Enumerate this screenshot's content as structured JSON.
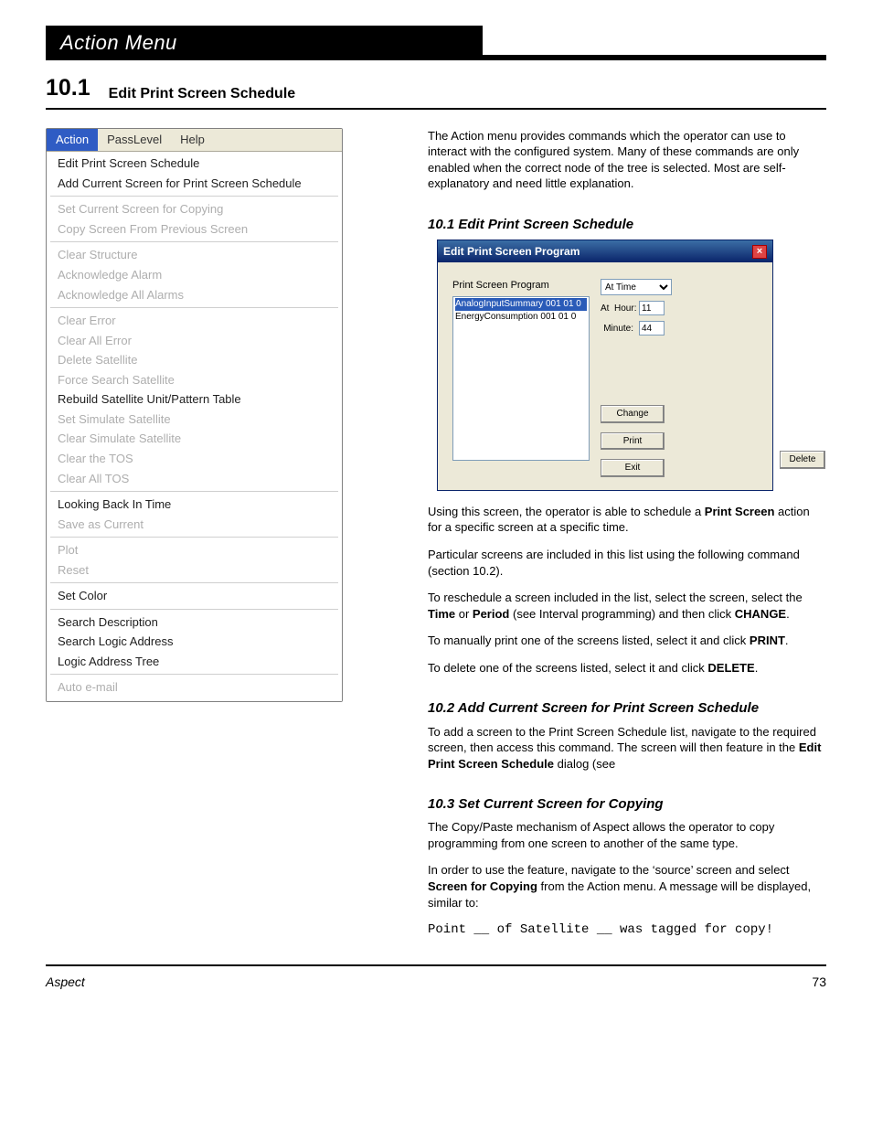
{
  "header": {
    "chapter_title": "Action Menu",
    "section_number": "10.1",
    "section_name": "Edit Print Screen Schedule"
  },
  "menu": {
    "bar": {
      "action": "Action",
      "passlevel": "PassLevel",
      "help": "Help"
    },
    "items": [
      {
        "label": "Edit Print Screen Schedule",
        "enabled": true,
        "sep_after": false
      },
      {
        "label": "Add Current Screen for Print Screen Schedule",
        "enabled": true,
        "sep_after": true
      },
      {
        "label": "Set Current Screen for Copying",
        "enabled": false,
        "sep_after": false
      },
      {
        "label": "Copy Screen From Previous Screen",
        "enabled": false,
        "sep_after": true
      },
      {
        "label": "Clear Structure",
        "enabled": false,
        "sep_after": false
      },
      {
        "label": "Acknowledge Alarm",
        "enabled": false,
        "sep_after": false
      },
      {
        "label": "Acknowledge All Alarms",
        "enabled": false,
        "sep_after": true
      },
      {
        "label": "Clear Error",
        "enabled": false,
        "sep_after": false
      },
      {
        "label": "Clear All Error",
        "enabled": false,
        "sep_after": false
      },
      {
        "label": "Delete Satellite",
        "enabled": false,
        "sep_after": false
      },
      {
        "label": "Force Search Satellite",
        "enabled": false,
        "sep_after": false
      },
      {
        "label": "Rebuild Satellite Unit/Pattern Table",
        "enabled": true,
        "sep_after": false
      },
      {
        "label": "Set Simulate Satellite",
        "enabled": false,
        "sep_after": false
      },
      {
        "label": "Clear Simulate Satellite",
        "enabled": false,
        "sep_after": false
      },
      {
        "label": "Clear the TOS",
        "enabled": false,
        "sep_after": false
      },
      {
        "label": "Clear All TOS",
        "enabled": false,
        "sep_after": true
      },
      {
        "label": "Looking Back In Time",
        "enabled": true,
        "sep_after": false
      },
      {
        "label": "Save as Current",
        "enabled": false,
        "sep_after": true
      },
      {
        "label": "Plot",
        "enabled": false,
        "sep_after": false
      },
      {
        "label": "Reset",
        "enabled": false,
        "sep_after": true
      },
      {
        "label": "Set Color",
        "enabled": true,
        "sep_after": true
      },
      {
        "label": "Search Description",
        "enabled": true,
        "sep_after": false
      },
      {
        "label": "Search Logic Address",
        "enabled": true,
        "sep_after": false
      },
      {
        "label": "Logic Address Tree",
        "enabled": true,
        "sep_after": true
      },
      {
        "label": "Auto e-mail",
        "enabled": false,
        "sep_after": false
      }
    ]
  },
  "dialog": {
    "title": "Edit Print Screen Program",
    "list_label": "Print Screen Program",
    "list_items": [
      {
        "text": "AnalogInputSummary 001 01 0",
        "selected": true
      },
      {
        "text": "EnergyConsumption 001 01 0",
        "selected": false
      }
    ],
    "select_value": "At Time",
    "at_label": "At",
    "hour_label": "Hour:",
    "hour_value": "11",
    "minute_label": "Minute:",
    "minute_value": "44",
    "buttons": {
      "change": "Change",
      "print": "Print",
      "exit": "Exit",
      "delete": "Delete"
    }
  },
  "right": {
    "intro": "The Action menu provides commands which the operator can use to interact with the configured system. Many of these commands are only enabled when the correct node of the tree is selected. Most are self-explanatory and need little explanation.",
    "h1": "10.1       Edit Print Screen Schedule",
    "p1a": "Using this screen, the operator is able to schedule a ",
    "p1b": "Print Screen",
    "p1c": " action for a specific screen at a specific time.",
    "p2": "Particular screens are included in this list using the following command (section 10.2).",
    "p3a": "To reschedule a screen included in the list, select the screen, select the ",
    "p3b": "Time",
    "p3c": " or ",
    "p3d": "Period",
    "p3e": " (see Interval programming) and then click ",
    "p3f": "CHANGE",
    "p3g": ".",
    "p4a": "To manually print one of the screens listed, select it and click ",
    "p4b": "PRINT",
    "p4c": ".",
    "p5a": "To delete one of the screens listed, select it and click ",
    "p5b": "DELETE",
    "p5c": ".",
    "h2": "10.2       Add Current Screen for Print Screen Schedule",
    "p6a": "To add a screen to the Print Screen Schedule list, navigate to the required screen, then access this command. The screen will then feature in the ",
    "p6b": "Edit Print Screen Schedule",
    "p6c": " dialog (see",
    "h3": "10.3       Set Current Screen for Copying",
    "p7": "The Copy/Paste mechanism of Aspect allows the operator to copy programming from one screen to another of the same type.",
    "p8a": "In order to use the feature, navigate to the ‘source’ screen and select ",
    "p8b": "Screen for Copying",
    "p8c": " from the Action menu. A message will be displayed, similar to:",
    "mono": "Point __ of Satellite __ was tagged for copy!"
  },
  "footer": {
    "left": "Aspect",
    "right": "73"
  }
}
